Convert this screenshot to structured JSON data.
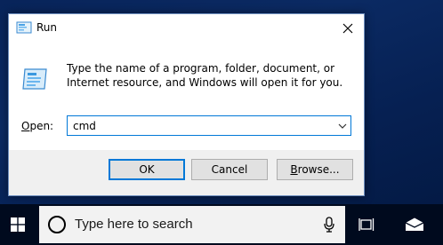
{
  "dialog": {
    "title": "Run",
    "message": "Type the name of a program, folder, document, or Internet resource, and Windows will open it for you.",
    "open_label_accel": "O",
    "open_label_rest": "pen:",
    "open_value": "cmd",
    "buttons": {
      "ok": "OK",
      "cancel": "Cancel",
      "browse_accel": "B",
      "browse_rest": "rowse..."
    },
    "accent_color": "#0078d7"
  },
  "taskbar": {
    "search_placeholder": "Type here to search",
    "icons": [
      "windows-logo-icon",
      "cortana-icon",
      "microphone-icon",
      "task-view-icon",
      "mail-icon"
    ]
  }
}
